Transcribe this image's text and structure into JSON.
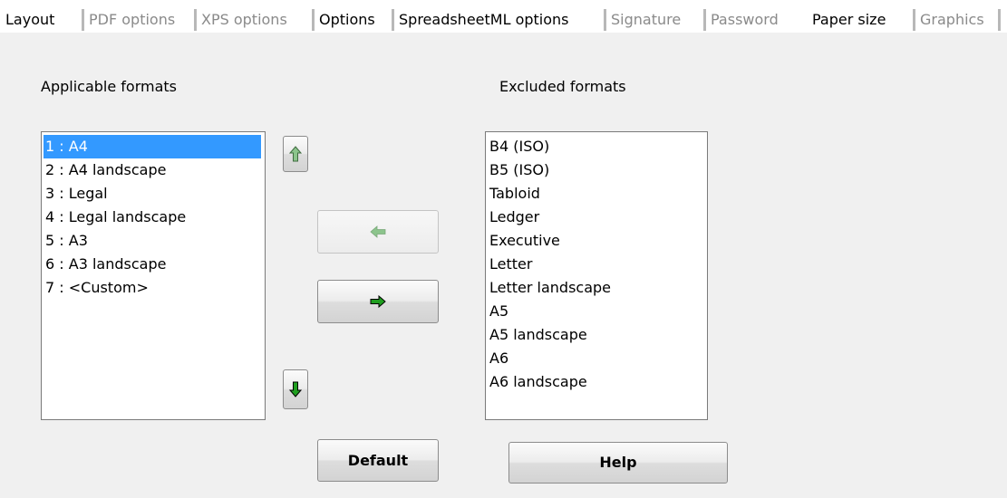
{
  "tabs": [
    {
      "label": "Layout",
      "state": "active"
    },
    {
      "label": "PDF options",
      "state": "inactive"
    },
    {
      "label": "XPS options",
      "state": "inactive"
    },
    {
      "label": "Options",
      "state": "active"
    },
    {
      "label": "SpreadsheetML options",
      "state": "active"
    },
    {
      "label": "Signature",
      "state": "inactive"
    },
    {
      "label": "Password",
      "state": "inactive"
    },
    {
      "label": "Paper size",
      "state": "active"
    },
    {
      "label": "Graphics",
      "state": "inactive"
    }
  ],
  "applicable": {
    "heading": "Applicable formats",
    "items": [
      "1 : A4",
      "2 : A4 landscape",
      "3 : Legal",
      "4 : Legal landscape",
      "5 : A3",
      "6 : A3 landscape",
      "7 : <Custom>"
    ],
    "selected_index": 0
  },
  "excluded": {
    "heading": "Excluded formats",
    "items": [
      "B4 (ISO)",
      "B5 (ISO)",
      "Tabloid",
      "Ledger",
      "Executive",
      "Letter",
      "Letter landscape",
      "A5",
      "A5 landscape",
      "A6",
      "A6 landscape"
    ]
  },
  "buttons": {
    "move_up_icon": "arrow-up-icon",
    "move_down_icon": "arrow-down-icon",
    "move_left_icon": "arrow-left-icon",
    "move_right_icon": "arrow-right-icon",
    "default_label": "Default",
    "help_label": "Help"
  },
  "colors": {
    "selection": "#3399ff",
    "arrow_green": "#1f9e1f",
    "arrow_disabled": "#8cc48c"
  }
}
